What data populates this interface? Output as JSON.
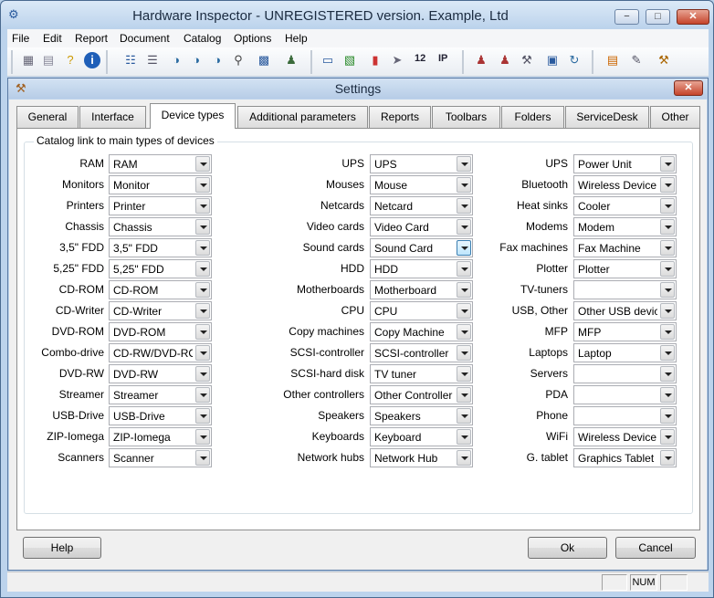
{
  "window": {
    "title": "Hardware Inspector - UNREGISTERED version. Example, Ltd",
    "minimize": "−",
    "maximize": "□",
    "close": "✕"
  },
  "menu": [
    "File",
    "Edit",
    "Report",
    "Document",
    "Catalog",
    "Options",
    "Help"
  ],
  "toolbar": {
    "icons": [
      "scanner-icon",
      "document-icon",
      "help-icon",
      "info-icon",
      "network-icon",
      "list-icon",
      "search-doc-icon",
      "search-doc2-icon",
      "search-doc3-icon",
      "magnifier-icon",
      "monitor-icon",
      "users-icon",
      "computer-icon",
      "card-icon",
      "chart-icon",
      "export-icon",
      "number-icon",
      "ip-icon",
      "person-icon",
      "people-icon",
      "tools-icon",
      "pc-network-icon",
      "refresh-icon",
      "report-icon",
      "edit-icon",
      "settings-icon"
    ],
    "num_label": "12",
    "ip_label": "IP"
  },
  "dialog": {
    "title": "Settings",
    "close": "✕",
    "tabs": [
      "General",
      "Interface",
      "Device types",
      "Additional parameters",
      "Reports",
      "Toolbars",
      "Folders",
      "ServiceDesk",
      "Other"
    ],
    "active_tab": "Device types",
    "group_title": "Catalog link to main types of devices",
    "col1": [
      {
        "label": "RAM",
        "value": "RAM"
      },
      {
        "label": "Monitors",
        "value": "Monitor"
      },
      {
        "label": "Printers",
        "value": "Printer"
      },
      {
        "label": "Chassis",
        "value": "Chassis"
      },
      {
        "label": "3,5\" FDD",
        "value": "3,5\" FDD"
      },
      {
        "label": "5,25\" FDD",
        "value": "5,25\" FDD"
      },
      {
        "label": "CD-ROM",
        "value": "CD-ROM"
      },
      {
        "label": "CD-Writer",
        "value": "CD-Writer"
      },
      {
        "label": "DVD-ROM",
        "value": "DVD-ROM"
      },
      {
        "label": "Combo-drive",
        "value": "CD-RW/DVD-ROM"
      },
      {
        "label": "DVD-RW",
        "value": "DVD-RW"
      },
      {
        "label": "Streamer",
        "value": "Streamer"
      },
      {
        "label": "USB-Drive",
        "value": "USB-Drive"
      },
      {
        "label": "ZIP-Iomega",
        "value": "ZIP-Iomega"
      },
      {
        "label": "Scanners",
        "value": "Scanner"
      }
    ],
    "col2": [
      {
        "label": "UPS",
        "value": "UPS"
      },
      {
        "label": "Mouses",
        "value": "Mouse"
      },
      {
        "label": "Netcards",
        "value": "Netcard"
      },
      {
        "label": "Video cards",
        "value": "Video Card"
      },
      {
        "label": "Sound cards",
        "value": "Sound Card"
      },
      {
        "label": "HDD",
        "value": "HDD"
      },
      {
        "label": "Motherboards",
        "value": "Motherboard"
      },
      {
        "label": "CPU",
        "value": "CPU"
      },
      {
        "label": "Copy machines",
        "value": "Copy Machine"
      },
      {
        "label": "SCSI-controller",
        "value": "SCSI-controller"
      },
      {
        "label": "SCSI-hard disk",
        "value": "TV tuner"
      },
      {
        "label": "Other controllers",
        "value": "Other Controller"
      },
      {
        "label": "Speakers",
        "value": "Speakers"
      },
      {
        "label": "Keyboards",
        "value": "Keyboard"
      },
      {
        "label": "Network hubs",
        "value": "Network Hub"
      }
    ],
    "col3": [
      {
        "label": "UPS",
        "value": "Power Unit"
      },
      {
        "label": "Bluetooth",
        "value": "Wireless Device"
      },
      {
        "label": "Heat sinks",
        "value": "Cooler"
      },
      {
        "label": "Modems",
        "value": "Modem"
      },
      {
        "label": "Fax machines",
        "value": "Fax Machine"
      },
      {
        "label": "Plotter",
        "value": "Plotter"
      },
      {
        "label": "TV-tuners",
        "value": ""
      },
      {
        "label": "USB, Other",
        "value": "Other USB device"
      },
      {
        "label": "MFP",
        "value": "MFP"
      },
      {
        "label": "Laptops",
        "value": "Laptop"
      },
      {
        "label": "Servers",
        "value": ""
      },
      {
        "label": "PDA",
        "value": ""
      },
      {
        "label": "Phone",
        "value": ""
      },
      {
        "label": "WiFi",
        "value": "Wireless Device"
      },
      {
        "label": "G. tablet",
        "value": "Graphics Tablet"
      }
    ],
    "help_button": "Help",
    "ok_button": "Ok",
    "cancel_button": "Cancel"
  },
  "statusbar": {
    "num": "NUM"
  }
}
